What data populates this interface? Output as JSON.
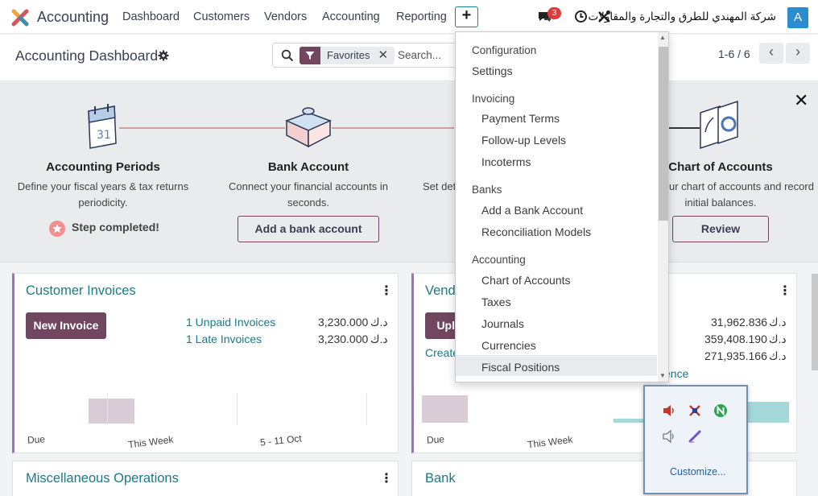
{
  "app": {
    "name": "Accounting"
  },
  "nav": {
    "menu": [
      "Dashboard",
      "Customers",
      "Vendors",
      "Accounting",
      "Reporting"
    ],
    "plus_label": "+",
    "chat_badge": "3",
    "company": "شركة المهندي للطرق والتجارة والمقاولات",
    "avatar": "A"
  },
  "control": {
    "title": "Accounting Dashboard",
    "facet_label": "Favorites",
    "facet_close": "✕",
    "search_placeholder": "Search...",
    "pager": "1-6 / 6",
    "prev": "‹",
    "next": "›"
  },
  "onboarding": {
    "close": "✕",
    "steps": [
      {
        "title": "Accounting Periods",
        "desc1": "Define your fiscal years & tax returns",
        "desc2": "periodicity.",
        "status": "Step completed!"
      },
      {
        "title": "Bank Account",
        "desc1": "Connect your financial accounts in",
        "desc2": "seconds.",
        "button": "Add a bank account"
      },
      {
        "title": "",
        "desc1": "Set det",
        "desc2": ""
      },
      {
        "title": "Chart of Accounts",
        "desc1": "ur chart of accounts and record",
        "desc2": "initial balances.",
        "button": "Review"
      }
    ]
  },
  "cards": {
    "customer_invoices": {
      "title": "Customer Invoices",
      "button": "New Invoice",
      "rows": [
        {
          "label": "1 Unpaid Invoices",
          "amount": "3,230.000",
          "currency": "د.ك"
        },
        {
          "label": "1 Late Invoices",
          "amount": "3,230.000",
          "currency": "د.ك"
        }
      ],
      "axis": [
        "Due",
        "This Week",
        "5 - 11 Oct"
      ]
    },
    "vendor_bills": {
      "title": "Vend",
      "button": "Uplo",
      "link": "Create",
      "amounts": [
        {
          "amount": "31,962.836",
          "currency": "د.ك"
        },
        {
          "amount": "359,408.190",
          "currency": "د.ك"
        },
        {
          "amount": "271,935.166",
          "currency": "د.ك"
        }
      ],
      "partial_link": "ence",
      "axis": [
        "Due",
        "This Week"
      ]
    },
    "misc": {
      "title": "Miscellaneous Operations"
    },
    "bank": {
      "title": "Bank"
    }
  },
  "dropdown": {
    "sections": [
      {
        "header": "Configuration",
        "items": [
          "Settings"
        ]
      },
      {
        "header": "Invoicing",
        "items": [
          "Payment Terms",
          "Follow-up Levels",
          "Incoterms"
        ]
      },
      {
        "header": "Banks",
        "items": [
          "Add a Bank Account",
          "Reconciliation Models"
        ]
      },
      {
        "header": "Accounting",
        "items": [
          "Chart of Accounts",
          "Taxes",
          "Journals",
          "Currencies",
          "Fiscal Positions"
        ]
      }
    ],
    "highlighted": "Fiscal Positions"
  },
  "tray": {
    "customize": "Customize..."
  },
  "colors": {
    "brand": "#71475f",
    "teal": "#1b7a86",
    "accent": "#a36fc0"
  }
}
